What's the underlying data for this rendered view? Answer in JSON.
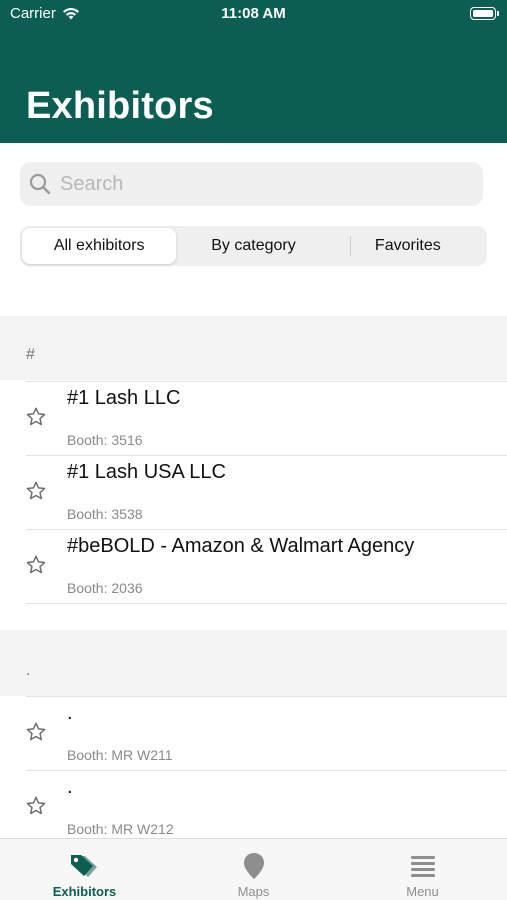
{
  "status_bar": {
    "carrier": "Carrier",
    "time": "11:08 AM"
  },
  "header": {
    "title": "Exhibitors",
    "background": "#0c5e52"
  },
  "search": {
    "placeholder": "Search",
    "value": ""
  },
  "segments": [
    {
      "label": "All exhibitors",
      "selected": true
    },
    {
      "label": "By category",
      "selected": false
    },
    {
      "label": "Favorites",
      "selected": false
    }
  ],
  "sections": [
    {
      "label": "#",
      "rows": [
        {
          "name": "#1 Lash LLC",
          "booth": "Booth: 3516",
          "favorite": false
        },
        {
          "name": "#1 Lash USA LLC",
          "booth": "Booth: 3538",
          "favorite": false
        },
        {
          "name": "#beBOLD - Amazon & Walmart Agency",
          "booth": "Booth: 2036",
          "favorite": false
        }
      ]
    },
    {
      "label": ".",
      "rows": [
        {
          "name": ".",
          "booth": "Booth: MR W211",
          "favorite": false
        },
        {
          "name": ".",
          "booth": "Booth: MR W212",
          "favorite": false
        }
      ]
    }
  ],
  "tabbar": {
    "tabs": [
      {
        "label": "Exhibitors",
        "icon": "tag-icon",
        "active": true
      },
      {
        "label": "Maps",
        "icon": "map-pin-icon",
        "active": false
      },
      {
        "label": "Menu",
        "icon": "menu-icon",
        "active": false
      }
    ],
    "active_color": "#0c5e52"
  }
}
